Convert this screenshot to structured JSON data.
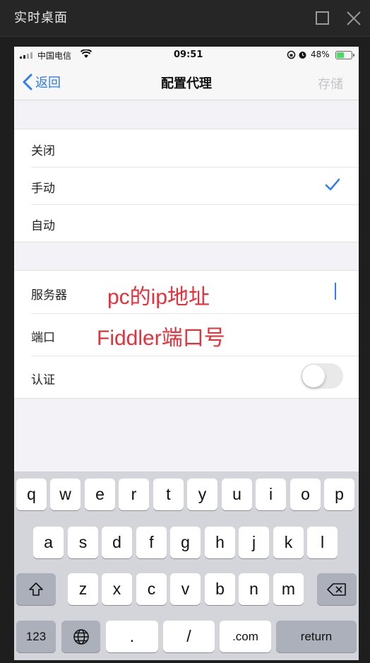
{
  "window": {
    "title": "实时桌面",
    "maximize_icon": "maximize-icon",
    "close_icon": "close-icon"
  },
  "status_bar": {
    "carrier": "中国电信",
    "time": "09:51",
    "battery_percent": "48%",
    "battery_level": 0.48,
    "battery_color": "#4cd964"
  },
  "nav": {
    "back_label": "返回",
    "title": "配置代理",
    "save_label": "存储",
    "accent": "#2f7cf6"
  },
  "proxy_modes": [
    {
      "label": "关闭",
      "selected": false
    },
    {
      "label": "手动",
      "selected": true
    },
    {
      "label": "自动",
      "selected": false
    }
  ],
  "server": {
    "server_label": "服务器",
    "server_annotation": "pc的ip地址",
    "port_label": "端口",
    "port_annotation": "Fiddler端口号",
    "auth_label": "认证",
    "auth_enabled": false
  },
  "keyboard": {
    "row1": [
      "q",
      "w",
      "e",
      "r",
      "t",
      "y",
      "u",
      "i",
      "o",
      "p"
    ],
    "row2": [
      "a",
      "s",
      "d",
      "f",
      "g",
      "h",
      "j",
      "k",
      "l"
    ],
    "row3": [
      "z",
      "x",
      "c",
      "v",
      "b",
      "n",
      "m"
    ],
    "numbers_key": "123",
    "dot_key": ".",
    "slash_key": "/",
    "com_key": ".com",
    "return_key": "return"
  }
}
